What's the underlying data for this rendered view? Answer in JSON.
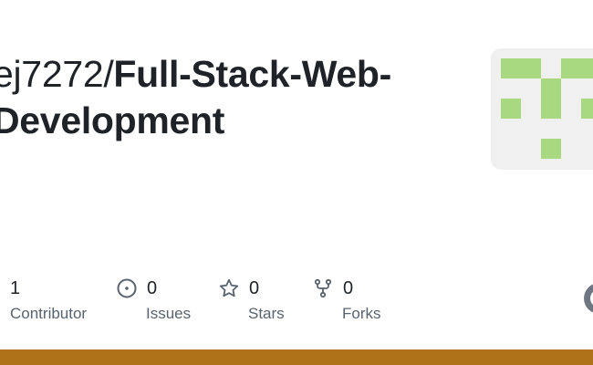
{
  "repo": {
    "owner": "ej7272",
    "separator": "/",
    "name_line1": "Full-Stack-Web-",
    "name_line2": "Development"
  },
  "stats": [
    {
      "icon": "people-icon",
      "count": "1",
      "label": "Contributor"
    },
    {
      "icon": "issue-opened-icon",
      "count": "0",
      "label": "Issues"
    },
    {
      "icon": "star-icon",
      "count": "0",
      "label": "Stars"
    },
    {
      "icon": "repo-forked-icon",
      "count": "0",
      "label": "Forks"
    }
  ],
  "avatar": {
    "background": "#f0f0f0",
    "pixel_color": "#a8d880"
  },
  "language_bar_color": "#b07219"
}
